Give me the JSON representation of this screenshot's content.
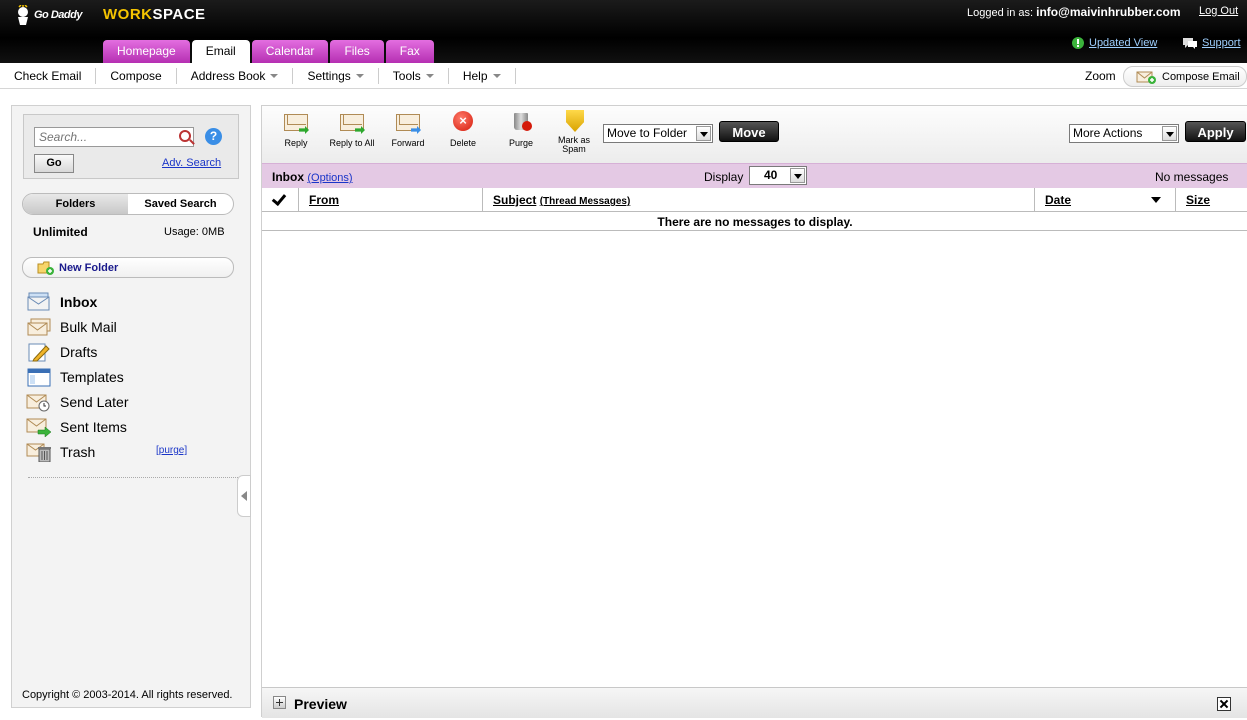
{
  "header": {
    "logo_text": "Go Daddy",
    "workspace_a": "WORK",
    "workspace_b": "SPACE",
    "logged_in_label": "Logged in as: ",
    "logged_in_email": "info@maivinhrubber.com",
    "logout": "Log Out",
    "updated_view": "Updated View",
    "support": "Support",
    "tabs": [
      "Homepage",
      "Email",
      "Calendar",
      "Files",
      "Fax"
    ]
  },
  "menubar": {
    "items": [
      "Check Email",
      "Compose",
      "Address Book",
      "Settings",
      "Tools",
      "Help"
    ],
    "zoom": "Zoom",
    "compose_email": "Compose Email"
  },
  "sidebar": {
    "search_placeholder": "Search...",
    "go": "Go",
    "adv_search": "Adv. Search",
    "tab_folders": "Folders",
    "tab_saved": "Saved Search",
    "quota": "Unlimited",
    "usage": "Usage: 0MB",
    "new_folder": "New Folder",
    "folders": [
      "Inbox",
      "Bulk Mail",
      "Drafts",
      "Templates",
      "Send Later",
      "Sent Items",
      "Trash"
    ],
    "purge": "[purge]",
    "copyright": "Copyright © 2003-2014. All rights reserved."
  },
  "toolbar": {
    "reply": "Reply",
    "reply_all": "Reply to All",
    "forward": "Forward",
    "delete": "Delete",
    "purge": "Purge",
    "spam_1": "Mark as",
    "spam_2": "Spam",
    "move_to_folder": "Move to Folder",
    "move": "Move",
    "more_actions": "More Actions",
    "apply": "Apply"
  },
  "inbox": {
    "title": "Inbox",
    "options": "(Options)",
    "display_label": "Display",
    "display_value": "40",
    "status": "No messages",
    "col_from": "From",
    "col_subject": "Subject",
    "col_thread": "(Thread Messages)",
    "col_date": "Date",
    "col_size": "Size",
    "empty": "There are no messages to display."
  },
  "preview": {
    "label": "Preview"
  }
}
